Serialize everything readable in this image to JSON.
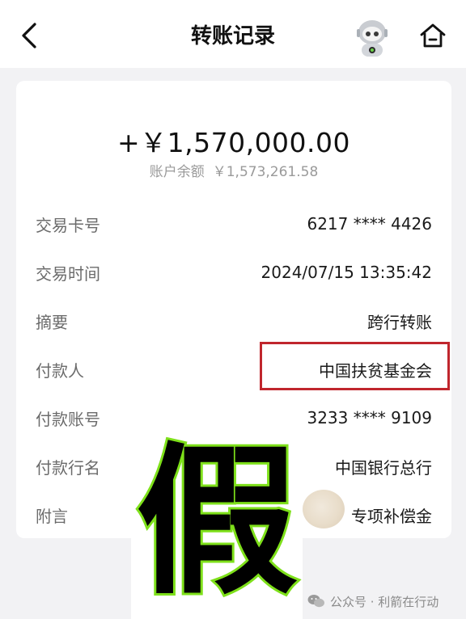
{
  "header": {
    "title": "转账记录",
    "back_icon": "chevron-left-icon",
    "home_icon": "home-icon",
    "assistant_icon": "robot-avatar-icon"
  },
  "summary": {
    "amount": "+￥1,570,000.00",
    "balance_label": "账户余额",
    "balance_value": "￥1,573,261.58"
  },
  "details": [
    {
      "label": "交易卡号",
      "value": "6217 **** 4426"
    },
    {
      "label": "交易时间",
      "value": "2024/07/15 13:35:42"
    },
    {
      "label": "摘要",
      "value": "跨行转账"
    },
    {
      "label": "付款人",
      "value": "中国扶贫基金会"
    },
    {
      "label": "付款账号",
      "value": "3233 **** 9109"
    },
    {
      "label": "付款行名",
      "value": "中国银行总行"
    },
    {
      "label": "附言",
      "value": "专项补偿金"
    }
  ],
  "overlay": {
    "fake_stamp": "假",
    "highlight_color": "#c0262d",
    "stamp_outline_color": "#7ee01a"
  },
  "watermark": {
    "text": "公众号 · 利箭在行动",
    "icon": "wechat-icon"
  }
}
